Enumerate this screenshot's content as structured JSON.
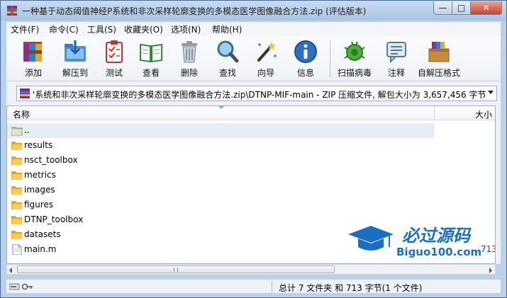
{
  "window": {
    "title": "一种基于动态阈值神经P系统和非次采样轮廓变换的多模态医学图像融合方法.zip (评估版本)",
    "min_glyph": "—",
    "max_glyph": "□",
    "close_glyph": "✕"
  },
  "menu": [
    "文件(F)",
    "命令(C)",
    "工具(S)",
    "收藏夹(O)",
    "选项(N)",
    "帮助(H)"
  ],
  "toolbar": {
    "add": "添加",
    "extract": "解压到",
    "test": "测试",
    "view": "查看",
    "delete": "删除",
    "find": "查找",
    "wizard": "向导",
    "info": "信息",
    "scan": "扫描病毒",
    "comment": "注释",
    "sfx": "自解压格式"
  },
  "address": {
    "path": "'系统和非次采样轮廓变换的多模态医学图像融合方法.zip\\DTNP-MIF-main - ZIP 压缩文件, 解包大小为 3,657,456 字节"
  },
  "columns": {
    "name": "名称",
    "size": "大小"
  },
  "files": [
    {
      "name": "..",
      "type": "parent"
    },
    {
      "name": "results",
      "type": "folder"
    },
    {
      "name": "nsct_toolbox",
      "type": "folder"
    },
    {
      "name": "metrics",
      "type": "folder"
    },
    {
      "name": "images",
      "type": "folder"
    },
    {
      "name": "figures",
      "type": "folder"
    },
    {
      "name": "DTNP_toolbox",
      "type": "folder"
    },
    {
      "name": "datasets",
      "type": "folder"
    },
    {
      "name": "main.m",
      "type": "file",
      "size": "713"
    }
  ],
  "status": {
    "summary": "总计 7 文件夹 和 713 字节(1 个文件)"
  },
  "watermark": {
    "brand": "必过源码",
    "url": "Biguo100.com"
  },
  "colors": {
    "folder": "#f2c448",
    "selection": "#e5edf7",
    "watermark": "#1a6fc4"
  }
}
